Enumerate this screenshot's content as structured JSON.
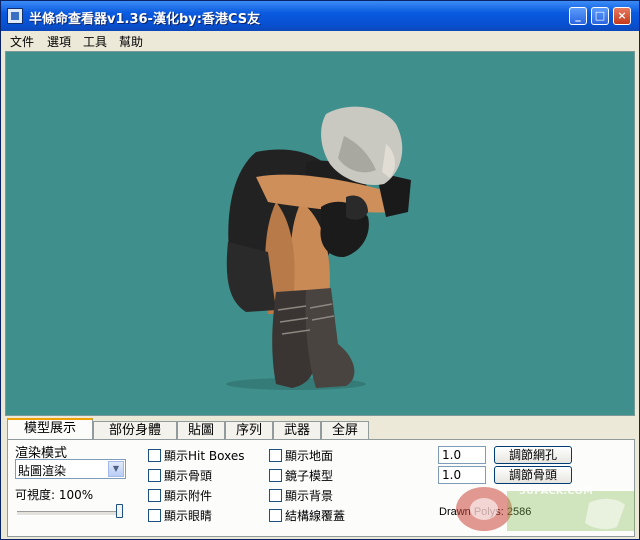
{
  "window": {
    "title": "半條命查看器v1.36-漢化by:香港CS友"
  },
  "menu": [
    {
      "label": "文件"
    },
    {
      "label": "選項"
    },
    {
      "label": "工具"
    },
    {
      "label": "幫助"
    }
  ],
  "tabs": [
    {
      "label": "模型展示",
      "active": true
    },
    {
      "label": "部份身體"
    },
    {
      "label": "貼圖"
    },
    {
      "label": "序列"
    },
    {
      "label": "武器"
    },
    {
      "label": "全屏"
    }
  ],
  "render_mode": {
    "label": "渲染模式",
    "selected": "貼圖渲染"
  },
  "visibility": {
    "label": "可視度: 100%",
    "value_percent": 100
  },
  "checkboxes": [
    {
      "label": "顯示Hit Boxes",
      "checked": false
    },
    {
      "label": "顯示骨頭",
      "checked": false
    },
    {
      "label": "顯示附件",
      "checked": false
    },
    {
      "label": "顯示眼睛",
      "checked": false
    },
    {
      "label": "顯示地面",
      "checked": false
    },
    {
      "label": "鏡子模型",
      "checked": false
    },
    {
      "label": "顯示背景",
      "checked": false
    },
    {
      "label": "結構線覆蓋",
      "checked": false
    }
  ],
  "grid": {
    "value": "1.0",
    "button_label": "調節網孔"
  },
  "bones": {
    "value": "1.0",
    "button_label": "調節骨頭"
  },
  "stats": {
    "drawn_polys": "Drawn Polys: 2586"
  },
  "watermark": {
    "text": "5UPACK.COM"
  },
  "colors": {
    "viewport_bg": "#3f8f8c",
    "titlebar": "#0a5ae0",
    "tab_accent": "#f0a000"
  }
}
